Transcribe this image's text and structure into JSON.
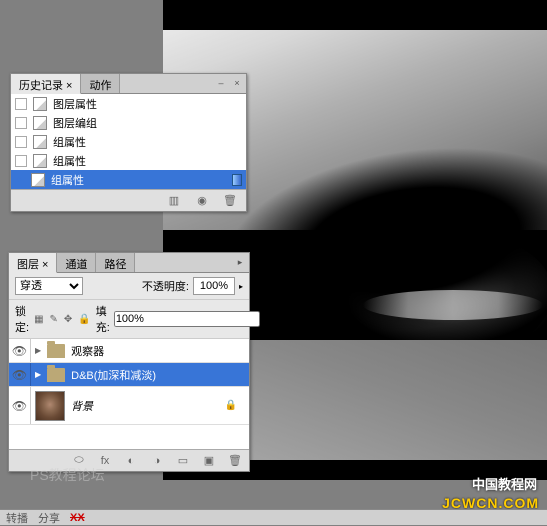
{
  "history_panel": {
    "tabs": [
      "历史记录",
      "动作"
    ],
    "close_label": "×",
    "items": [
      {
        "label": "图层属性",
        "selected": false
      },
      {
        "label": "图层编组",
        "selected": false
      },
      {
        "label": "组属性",
        "selected": false
      },
      {
        "label": "组属性",
        "selected": false
      },
      {
        "label": "组属性",
        "selected": true
      }
    ],
    "footer_icons": [
      "create-doc-icon",
      "snapshot-icon",
      "delete-icon"
    ]
  },
  "layers_panel": {
    "tabs": [
      "图层",
      "通道",
      "路径"
    ],
    "blend_mode": "穿透",
    "opacity_label": "不透明度:",
    "opacity_value": "100%",
    "lock_label": "锁定:",
    "fill_label": "填充:",
    "fill_value": "100%",
    "layers": [
      {
        "type": "group",
        "name": "观察器",
        "selected": false,
        "visible": true
      },
      {
        "type": "group",
        "name": "D&B(加深和减淡)",
        "selected": true,
        "visible": true
      },
      {
        "type": "image",
        "name": "背景",
        "selected": false,
        "visible": true,
        "locked": true
      }
    ]
  },
  "watermarks": {
    "left": "PS教程论坛",
    "right_top": "中国教程网",
    "url": "JCWCN.COM"
  },
  "status_bar": {
    "items": [
      "转播",
      "分享",
      "XX"
    ]
  }
}
